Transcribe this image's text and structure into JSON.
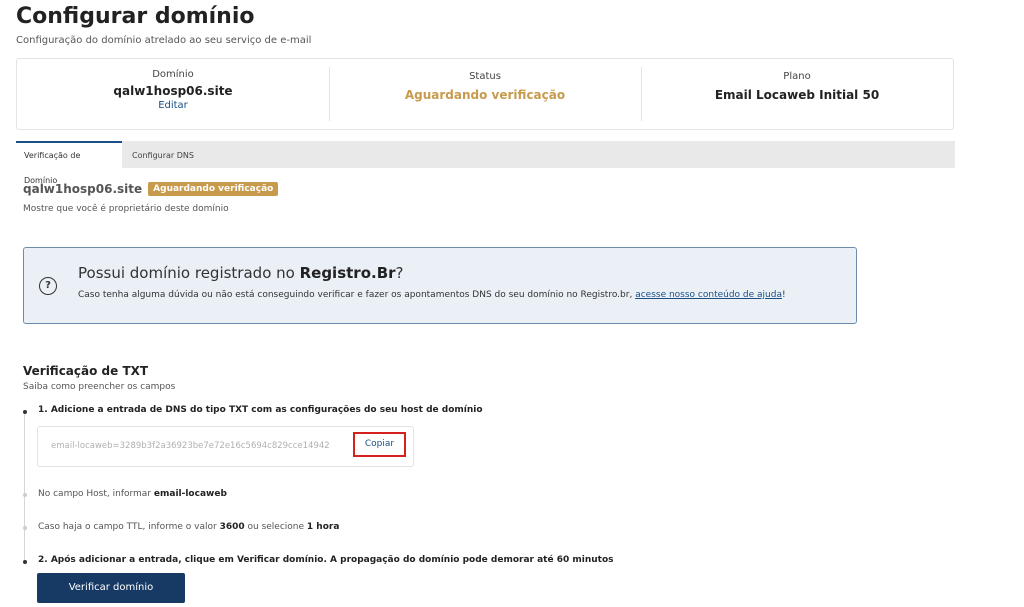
{
  "page": {
    "title": "Configurar domínio",
    "subtitle": "Configuração do domínio atrelado ao seu serviço de e-mail"
  },
  "summary": {
    "domain_label": "Domínio",
    "domain_value": "qalw1hosp06.site",
    "edit_link": "Editar",
    "status_label": "Status",
    "status_value": "Aguardando verificação",
    "plan_label": "Plano",
    "plan_value": "Email Locaweb Initial 50"
  },
  "tabs": [
    {
      "label": "Verificação de Domínio",
      "active": true
    },
    {
      "label": "Configurar DNS",
      "active": false
    }
  ],
  "verification": {
    "domain": "qalw1hosp06.site",
    "badge": "Aguardando verificação",
    "description": "Mostre que você é proprietário deste domínio"
  },
  "info_box": {
    "title_prefix": "Possui domínio registrado no ",
    "title_bold": "Registro.Br",
    "title_suffix": "?",
    "text": "Caso tenha alguma dúvida ou não está conseguindo verificar e fazer os apontamentos DNS do seu domínio no Registro.br, ",
    "link": "acesse nosso conteúdo de ajuda",
    "text_end": "!",
    "icon": "question-circle-icon"
  },
  "txt": {
    "title": "Verificação de TXT",
    "subtitle": "Saiba como preencher os campos",
    "step1": "1. Adicione a entrada de DNS do tipo TXT com as configurações do seu host de domínio",
    "dns_value": "email-locaweb=3289b3f2a36923be7e72e16c5694c829cce14942",
    "copy_label": "Copiar",
    "host_prefix": "No campo Host, informar ",
    "host_value": "email-locaweb",
    "ttl_prefix": "Caso haja o campo TTL, informe o valor ",
    "ttl_value": "3600",
    "ttl_middle": " ou selecione ",
    "ttl_option": "1 hora",
    "step2": "2. Após adicionar a entrada, clique em Verificar domínio. A propagação do domínio pode demorar até 60 minutos",
    "verify_button": "Verificar domínio"
  },
  "colors": {
    "accent": "#1a4f86",
    "status": "#c89a4c",
    "primary_button": "#173a64",
    "highlight_border": "#d62020"
  }
}
